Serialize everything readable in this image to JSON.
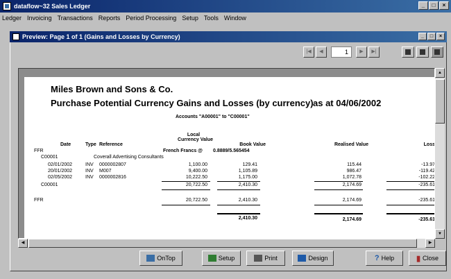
{
  "app": {
    "title": "dataflow~32 Sales Ledger"
  },
  "menu": [
    {
      "label": "Ledger"
    },
    {
      "label": "Invoicing"
    },
    {
      "label": "Transactions"
    },
    {
      "label": "Reports"
    },
    {
      "label": "Period Processing"
    },
    {
      "label": "Setup"
    },
    {
      "label": "Tools"
    },
    {
      "label": "Window"
    }
  ],
  "preview": {
    "title": "Preview: Page 1 of 1 (Gains and Losses by Currency)",
    "page_value": "1"
  },
  "report": {
    "company": "Miles Brown and Sons & Co.",
    "title": "Purchase Potential Currency Gains and Losses (by currency)",
    "as_at": "as at 04/06/2002",
    "accounts_line": "Accounts \"A00001\" to \"C00001\"",
    "headers": {
      "date": "Date",
      "type": "Type",
      "reference": "Reference",
      "local_1": "Local",
      "local_2": "Currency Value",
      "book": "Book Value",
      "realised": "Realised Value",
      "loss": "Loss"
    },
    "currency_label": "French Francs @",
    "currency_rate": "0.8889/5.565454",
    "currency_code": "FFR",
    "account_code": "C00001",
    "account_name": "Coverall Advertising Consultants",
    "rows": [
      {
        "date": "02/01/2002",
        "type": "INV",
        "ref": "0000002807",
        "local": "1,100.00",
        "book": "129.41",
        "realised": "115.44",
        "loss": "-13.97"
      },
      {
        "date": "20/01/2002",
        "type": "INV",
        "ref": "M007",
        "local": "9,400.00",
        "book": "1,105.89",
        "realised": "986.47",
        "loss": "-119.42"
      },
      {
        "date": "02/05/2002",
        "type": "INV",
        "ref": "0000002816",
        "local": "10,222.50",
        "book": "1,175.00",
        "realised": "1,072.78",
        "loss": "-102.22"
      }
    ],
    "account_total": {
      "label": "C00001",
      "local": "20,722.50",
      "book": "2,410.30",
      "realised": "2,174.69",
      "loss": "-235.61"
    },
    "currency_total": {
      "label": "FFR",
      "local": "20,722.50",
      "book": "2,410.30",
      "realised": "2,174.69",
      "loss": "-235.61"
    },
    "grand_total": {
      "book": "2,410.30",
      "realised": "2,174.69",
      "loss": "-235.61"
    }
  },
  "buttons": {
    "ontop": "OnTop",
    "setup": "Setup",
    "print": "Print",
    "design": "Design",
    "help": "Help",
    "close": "Close"
  },
  "colors": {
    "title_bar": "#0a246a",
    "title_bar_end": "#3a6ea5",
    "chrome": "#c0c0c0"
  }
}
